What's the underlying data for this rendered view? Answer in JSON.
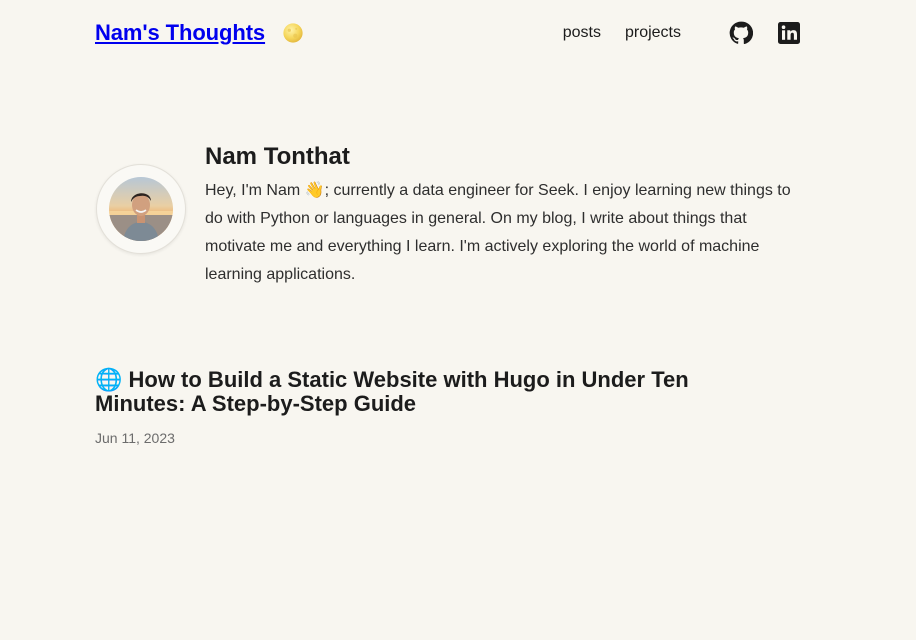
{
  "header": {
    "site_title": "Nam's Thoughts",
    "theme_icon": "moon-icon",
    "nav": [
      {
        "label": "posts"
      },
      {
        "label": "projects"
      }
    ],
    "social": [
      {
        "name": "github-icon"
      },
      {
        "name": "linkedin-icon"
      }
    ]
  },
  "profile": {
    "name": "Nam Tonthat",
    "bio": "Hey, I'm Nam 👋; currently a data engineer for Seek. I enjoy learning new things to do with Python or languages in general. On my blog, I write about things that motivate me and everything I learn. I'm actively exploring the world of machine learning applications."
  },
  "posts": [
    {
      "title": "🌐 How to Build a Static Website with Hugo in Under Ten Minutes: A Step-by-Step Guide",
      "date": "Jun 11, 2023"
    }
  ],
  "colors": {
    "background": "#f8f6f0",
    "text": "#1c1c1c",
    "muted": "#6c6c6c"
  }
}
